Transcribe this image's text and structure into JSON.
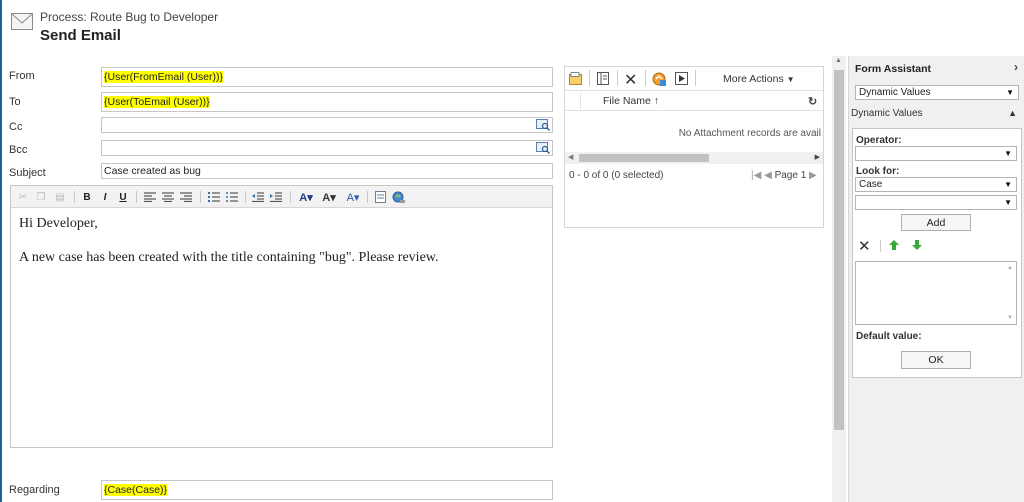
{
  "header": {
    "process": "Process: Route Bug to Developer",
    "title": "Send Email"
  },
  "form": {
    "from": {
      "label": "From",
      "value": "{User(FromEmail (User))}"
    },
    "to": {
      "label": "To",
      "value": "{User(ToEmail (User))}"
    },
    "cc": {
      "label": "Cc",
      "value": ""
    },
    "bcc": {
      "label": "Bcc",
      "value": ""
    },
    "subject": {
      "label": "Subject",
      "value": "Case created as bug"
    },
    "regarding": {
      "label": "Regarding",
      "value": "{Case(Case)}"
    }
  },
  "editor": {
    "line1": "Hi Developer,",
    "line2": "A new case has been created with the title containing \"bug\". Please review."
  },
  "attachments": {
    "more_actions": "More Actions",
    "column_file_name": "File Name",
    "empty_message": "No Attachment records are avail",
    "status": "0 - 0 of 0 (0 selected)",
    "page": "Page 1"
  },
  "form_assistant": {
    "title": "Form Assistant",
    "dropdown_value": "Dynamic Values",
    "section": "Dynamic Values",
    "operator_label": "Operator:",
    "operator_value": "",
    "look_for_label": "Look for:",
    "look_for_value": "Case",
    "field_value": "",
    "add_label": "Add",
    "default_value_label": "Default value:",
    "ok_label": "OK"
  },
  "colors": {
    "highlight": "#ffff00",
    "accent": "#1e5fa0"
  }
}
